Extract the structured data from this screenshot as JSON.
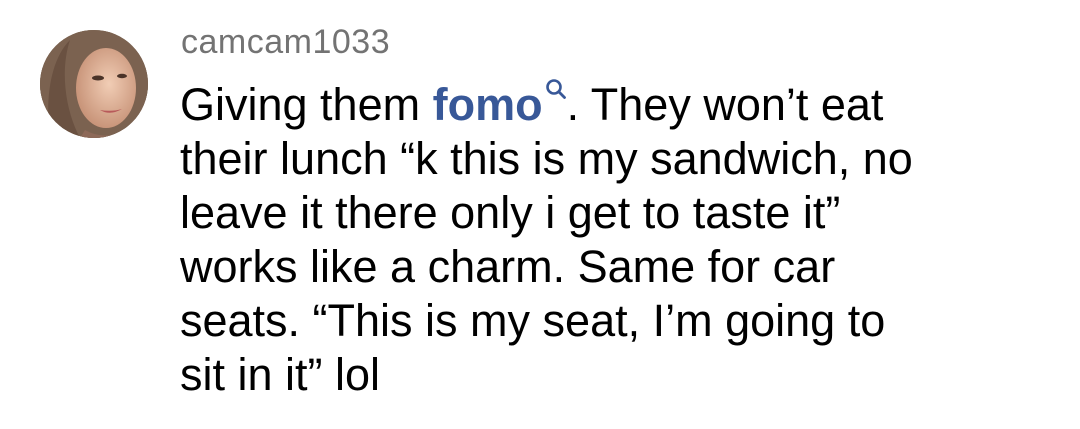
{
  "comment": {
    "username": "camcam1033",
    "lines": {
      "l1_before": "Giving them ",
      "l1_tag": "fomo",
      "l1_after": ". They won’t eat",
      "l2": "their lunch “k this is my sandwich, no",
      "l3": "leave it there only i get to taste it”",
      "l4": "works like a charm. Same for car",
      "l5": "seats. “This is my seat, I’m going to",
      "l6": "sit in it” lol"
    },
    "icons": {
      "search": "search-icon"
    },
    "colors": {
      "username": "#737373",
      "text": "#000000",
      "hashtag": "#385898"
    }
  }
}
